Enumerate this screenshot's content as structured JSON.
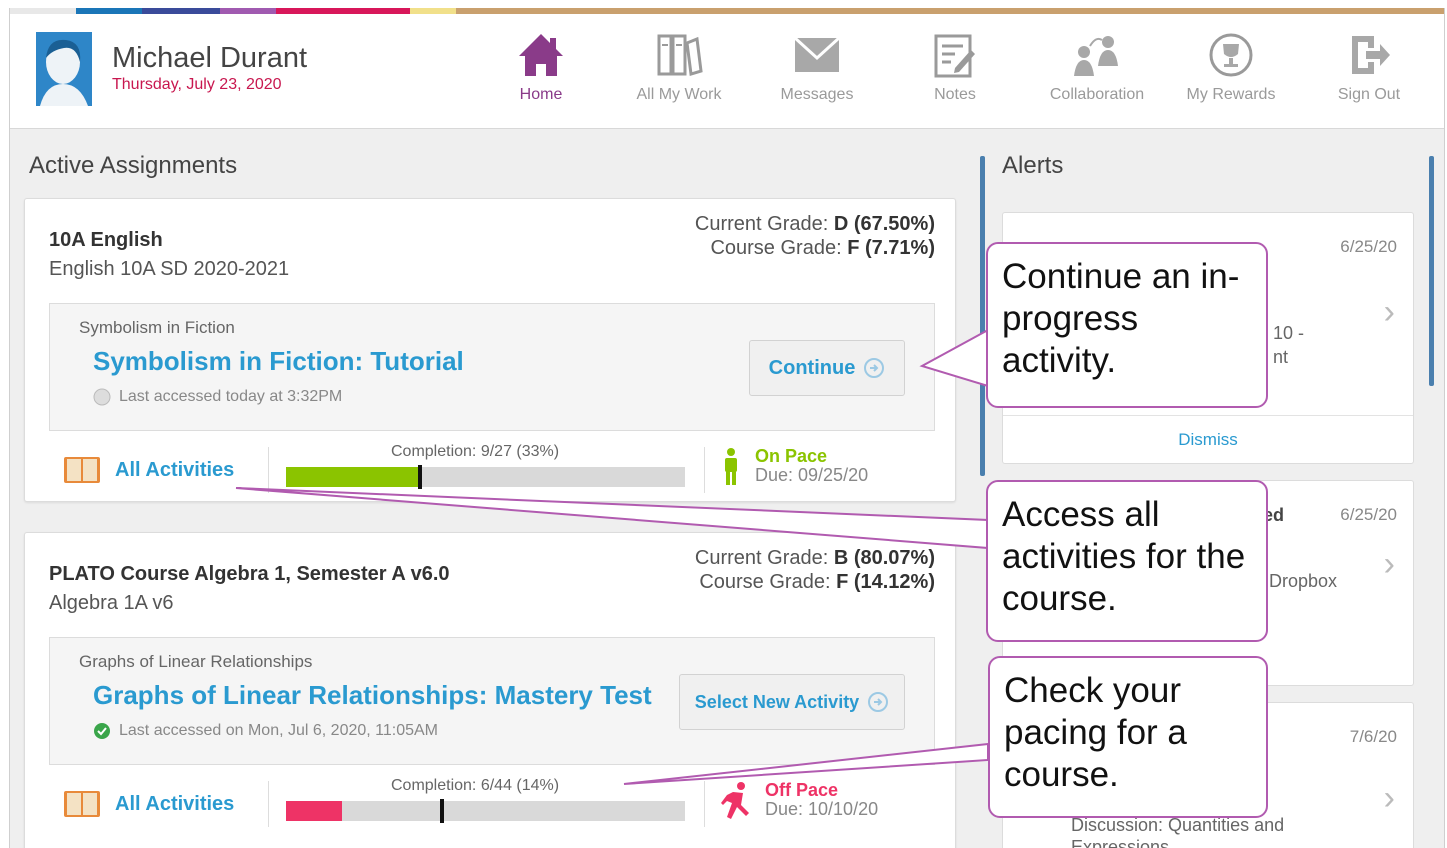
{
  "header": {
    "user_name": "Michael Durant",
    "date": "Thursday, July 23, 2020",
    "nav": [
      {
        "label": "Home",
        "icon": "home-icon",
        "active": true
      },
      {
        "label": "All My Work",
        "icon": "books-icon"
      },
      {
        "label": "Messages",
        "icon": "envelope-icon"
      },
      {
        "label": "Notes",
        "icon": "notepad-icon"
      },
      {
        "label": "Collaboration",
        "icon": "collaboration-icon"
      },
      {
        "label": "My Rewards",
        "icon": "trophy-icon"
      },
      {
        "label": "Sign Out",
        "icon": "sign-out-icon"
      }
    ]
  },
  "colors": {
    "accent": "#2a9ad0",
    "active_nav": "#8a3b89",
    "on_pace": "#8bc400",
    "off_pace": "#ee3366",
    "callout_border": "#b15bb0"
  },
  "assignments": {
    "title": "Active Assignments",
    "cards": [
      {
        "course": "10A English",
        "subtitle": "English 10A SD 2020-2021",
        "current_grade_label": "Current Grade:",
        "current_grade": "D (67.50%)",
        "course_grade_label": "Course Grade:",
        "course_grade": "F (7.71%)",
        "lesson": "Symbolism in Fiction",
        "activity_title": "Symbolism in Fiction: Tutorial",
        "last_accessed": "Last accessed today at 3:32PM",
        "button": "Continue",
        "all_activities": "All Activities",
        "completion": "Completion: 9/27 (33%)",
        "completion_fraction": 0.33,
        "pace": "On Pace",
        "due": "Due: 09/25/20"
      },
      {
        "course": "PLATO Course Algebra 1, Semester A v6.0",
        "subtitle": "Algebra 1A v6",
        "current_grade_label": "Current Grade:",
        "current_grade": "B (80.07%)",
        "course_grade_label": "Course Grade:",
        "course_grade": "F (14.12%)",
        "lesson": "Graphs of Linear Relationships",
        "activity_title": "Graphs of Linear Relationships: Mastery Test",
        "last_accessed": "Last accessed on Mon, Jul 6, 2020, 11:05AM",
        "button": "Select New Activity",
        "all_activities": "All Activities",
        "completion": "Completion: 6/44 (14%)",
        "completion_fraction": 0.14,
        "pace": "Off Pace",
        "due": "Due: 10/10/20"
      }
    ]
  },
  "alerts": {
    "title": "Alerts",
    "items": [
      {
        "date": "6/25/20",
        "partial_a": "10 -",
        "partial_b": "nt",
        "dismiss": "Dismiss"
      },
      {
        "date": "6/25/20",
        "partial_a": "ed",
        "partial_b": "Dropbox"
      },
      {
        "date": "7/6/20",
        "partial_a": "Discussion: Quantities and",
        "partial_b": "Expressions"
      }
    ]
  },
  "callouts": [
    "Continue an in-progress activity.",
    "Access all activities for the course.",
    "Check your pacing for a course."
  ]
}
